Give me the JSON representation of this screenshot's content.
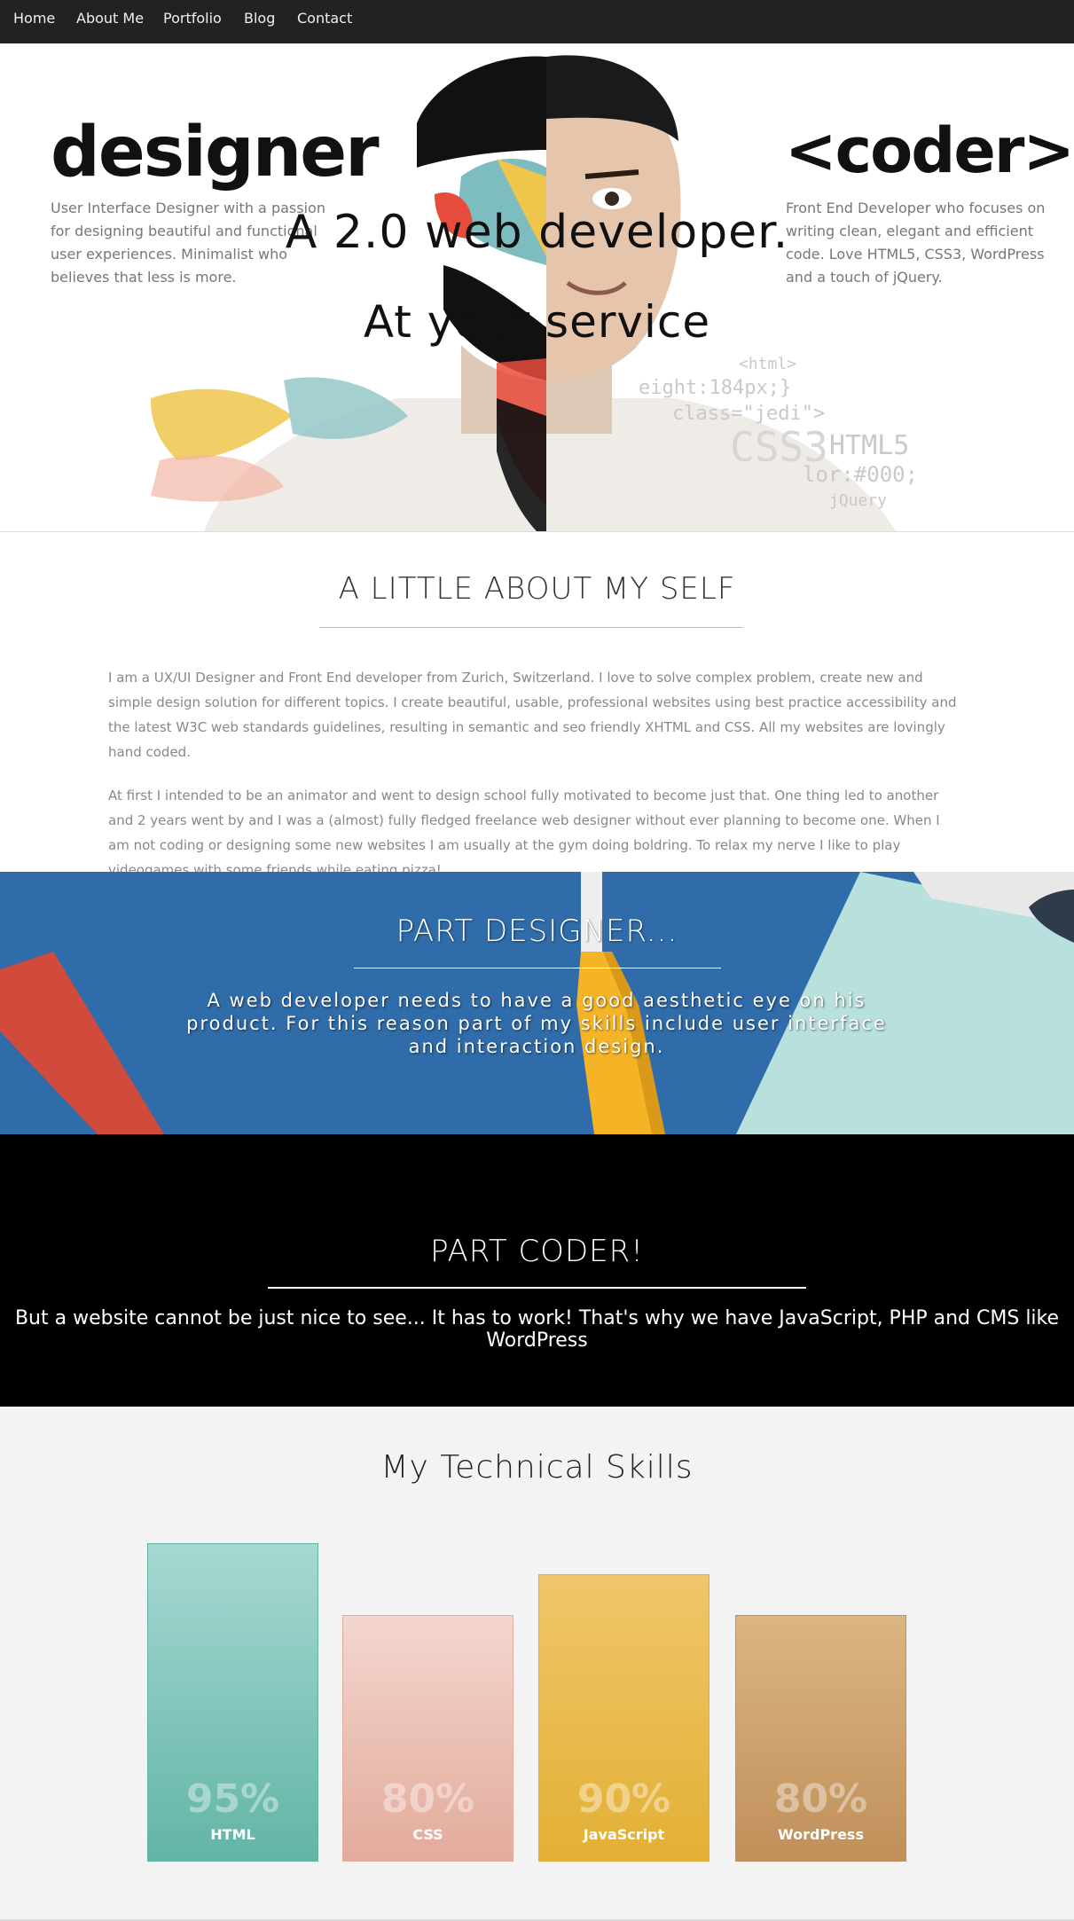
{
  "nav": {
    "items": [
      "Home",
      "About Me",
      "Portfolio",
      "Blog",
      "Contact"
    ]
  },
  "hero": {
    "designer_title": "designer",
    "designer_desc": [
      "User Interface Designer with a passion",
      "for designing beautiful and functional",
      "user experiences. Minimalist who",
      "believes that less is more."
    ],
    "coder_title": "<coder>",
    "coder_desc": [
      "Front End Developer who focuses on",
      "writing clean, elegant and efficient",
      "code. Love HTML5, CSS3, WordPress",
      "and a touch of jQuery."
    ],
    "headline_1": "A 2.0 web developer.",
    "headline_2": "At your service",
    "code_snippets": [
      "<html>",
      "eight:184px;}",
      "class=\"jedi\">",
      "CSS3",
      "HTML5",
      "lor:#000;",
      "jQuery"
    ]
  },
  "about": {
    "title": "A LITTLE ABOUT MY SELF",
    "paragraph_1": "I am a UX/UI Designer and Front End developer from Zurich, Switzerland. I love to solve complex problem, create new and simple design solution for different topics. I create beautiful, usable, professional websites using best practice accessibility and the latest W3C web standards guidelines, resulting in semantic and seo friendly XHTML and CSS. All my websites are lovingly hand coded.",
    "paragraph_2": "At first I intended to be an animator and went to design school fully motivated to become just that. One thing led to another and 2 years went by and I was a (almost) fully fledged freelance web designer without ever planning to become one. When I am not coding or designing some new websites I am usually at the gym doing boldring. To relax my nerve I like to play videogames with some friends while eating pizza! ."
  },
  "designer": {
    "title": "PART DESIGNER...",
    "text": "A web developer needs to have a good aesthetic eye on his product. For this reason part of my skills include user interface and interaction design."
  },
  "coder": {
    "title": "PART CODER!",
    "text": "But a website cannot be just nice to see... It has to work! That's why we have JavaScript, PHP and CMS like WordPress"
  },
  "skills": {
    "title": "My Technical Skills",
    "items": [
      {
        "label": "HTML",
        "percent": "95%",
        "color_top": "#a6d8d2",
        "color_bottom": "#62b5a6"
      },
      {
        "label": "CSS",
        "percent": "80%",
        "color_top": "#f3d6cf",
        "color_bottom": "#e3ab9b"
      },
      {
        "label": "JavaScript",
        "percent": "90%",
        "color_top": "#efc66a",
        "color_bottom": "#e3b035"
      },
      {
        "label": "WordPress",
        "percent": "80%",
        "color_top": "#dbb682",
        "color_bottom": "#c08f5a"
      }
    ]
  }
}
